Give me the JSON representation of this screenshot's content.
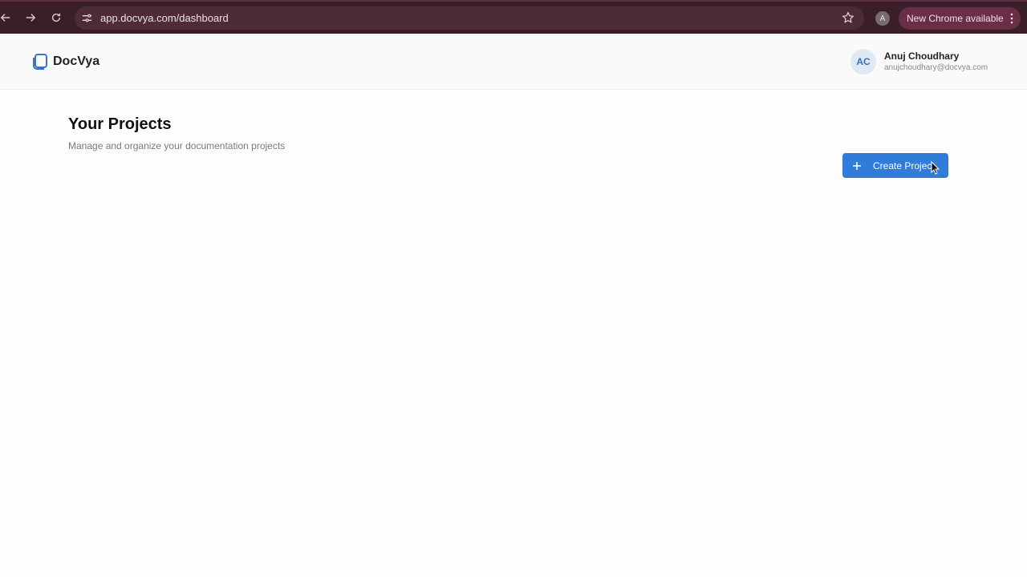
{
  "browser": {
    "url": "app.docvya.com/dashboard",
    "profile_initial": "A",
    "update_label": "New Chrome available"
  },
  "header": {
    "brand": "DocVya",
    "user": {
      "initials": "AC",
      "name": "Anuj Choudhary",
      "email": "anujchoudhary@docvya.com"
    }
  },
  "main": {
    "title": "Your Projects",
    "subtitle": "Manage and organize your documentation projects",
    "create_label": "Create Project"
  },
  "colors": {
    "accent": "#2f7dd8",
    "chrome_bg": "#3a1f2b"
  }
}
